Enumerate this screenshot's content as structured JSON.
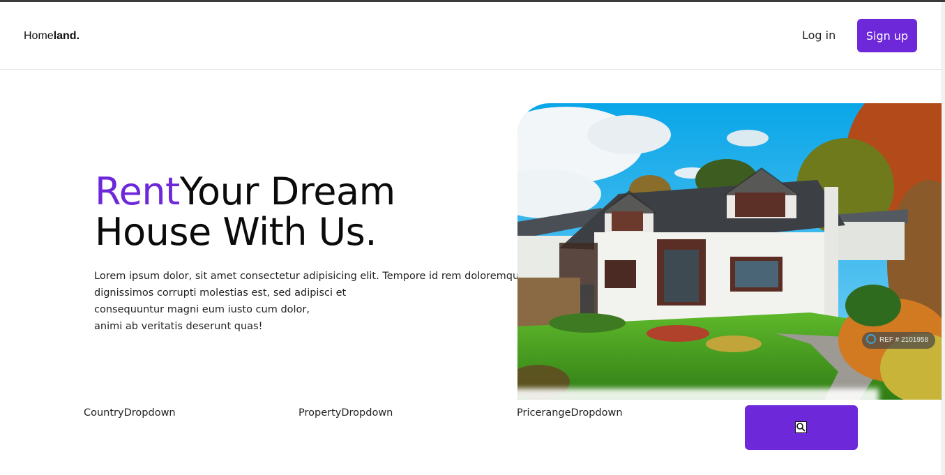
{
  "nav": {
    "logo_light": "Home",
    "logo_bold": "land.",
    "login_label": "Log in",
    "signup_label": "Sign up"
  },
  "hero": {
    "title_accent": "Rent",
    "title_line1_rest": "Your Dream",
    "title_line2": "House With Us.",
    "description_lines": [
      "Lorem ipsum dolor, sit amet consectetur adipisicing elit. Tempore id rem doloremque",
      "dignissimos corrupti molestias est, sed adipisci et",
      "consequuntur magni eum iusto cum dolor,",
      "animi ab veritatis deserunt quas!"
    ],
    "image_ref": "REF # 2101958"
  },
  "search": {
    "country_label": "CountryDropdown",
    "property_label": "PropertyDropdown",
    "pricerange_label": "PricerangeDropdown",
    "button_icon": "search-icon"
  },
  "colors": {
    "brand": "#6d28d9",
    "text": "#0b0b0b"
  }
}
